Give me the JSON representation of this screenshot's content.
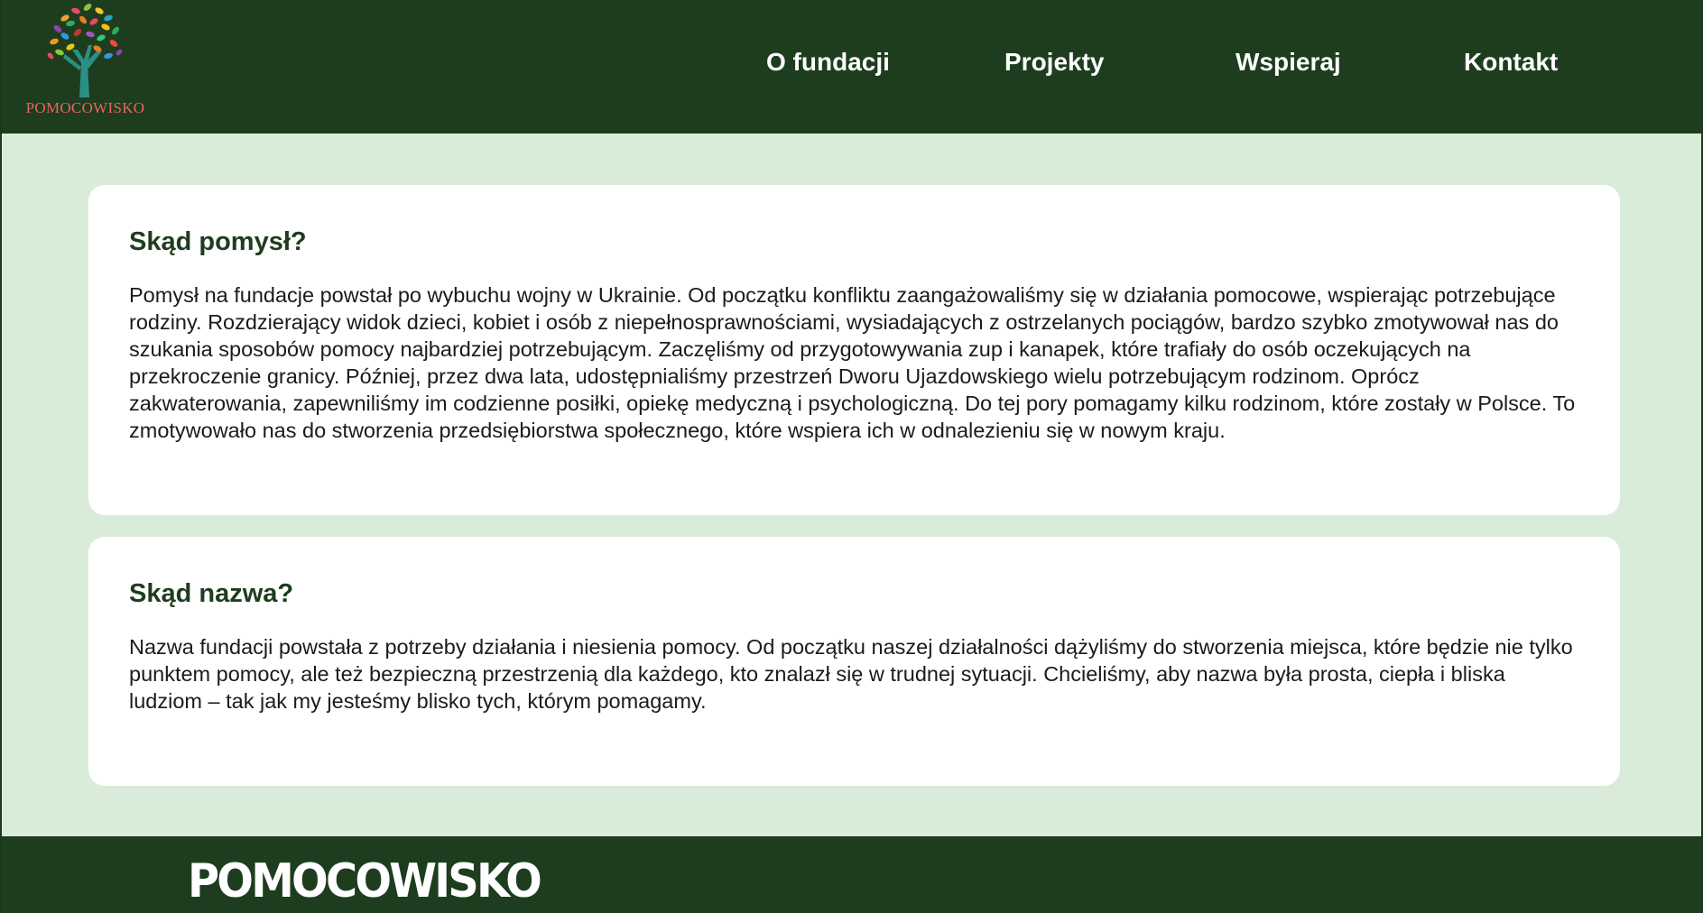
{
  "header": {
    "logo_text": "POMOCOWISKO",
    "nav": [
      {
        "label": "O fundacji"
      },
      {
        "label": "Projekty"
      },
      {
        "label": "Wspieraj"
      },
      {
        "label": "Kontakt"
      }
    ]
  },
  "main": {
    "sections": [
      {
        "title": "Skąd pomysł?",
        "body": "Pomysł na fundacje powstał po wybuchu wojny w Ukrainie. Od początku konfliktu zaangażowaliśmy się w działania pomocowe, wspierając potrzebujące rodziny. Rozdzierający widok dzieci, kobiet i osób z niepełnosprawnościami, wysiadających z ostrzelanych pociągów, bardzo szybko zmotywował nas do szukania sposobów pomocy najbardziej potrzebującym. Zaczęliśmy od przygotowywania zup i kanapek, które trafiały do osób oczekujących na przekroczenie granicy. Później, przez dwa lata, udostępnialiśmy przestrzeń Dworu Ujazdowskiego wielu potrzebującym rodzinom. Oprócz zakwaterowania, zapewniliśmy im codzienne posiłki, opiekę medyczną i psychologiczną. Do tej pory pomagamy kilku rodzinom, które zostały w Polsce. To zmotywowało nas do stworzenia przedsiębiorstwa społecznego, które wspiera ich w odnalezieniu się w nowym kraju."
      },
      {
        "title": "Skąd nazwa?",
        "body": "Nazwa fundacji powstała z potrzeby działania i niesienia pomocy. Od początku naszej działalności dążyliśmy do stworzenia miejsca, które będzie nie tylko punktem pomocy, ale też bezpieczną przestrzenią dla każdego, kto znalazł się w trudnej sytuacji. Chcieliśmy, aby nazwa była prosta, ciepła i bliska ludziom – tak jak my jesteśmy blisko tych, którym pomagamy."
      }
    ]
  },
  "footer": {
    "brand": "POMOCOWISKO"
  },
  "colors": {
    "header_bg": "#1e3d1f",
    "page_bg": "#d9ecda",
    "card_bg": "#ffffff",
    "heading": "#1e3d1f",
    "logo_text": "#e8655f"
  },
  "icons": {
    "logo": "tree-logo-icon"
  }
}
